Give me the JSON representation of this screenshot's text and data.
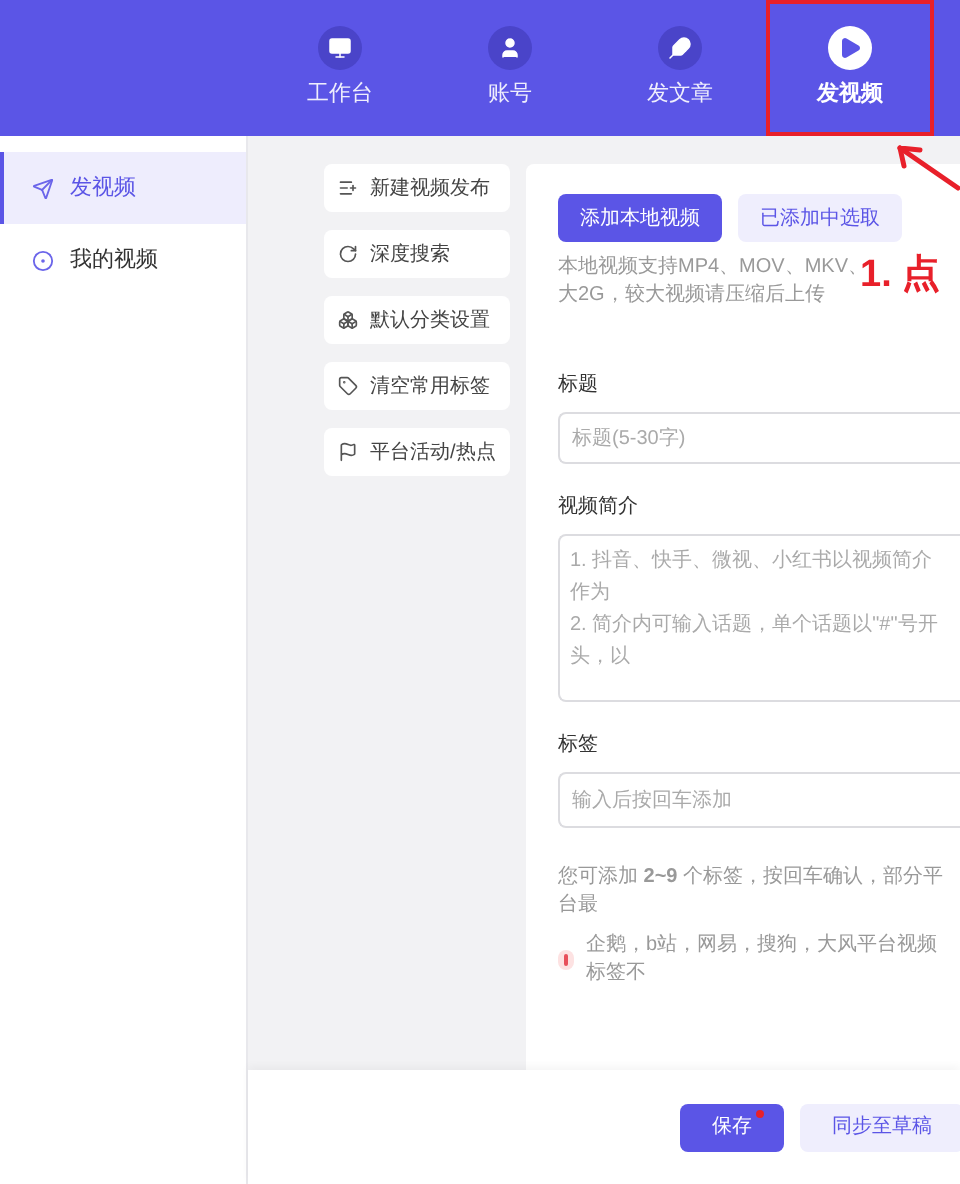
{
  "top_tabs": [
    {
      "label": "工作台",
      "selected": false,
      "highlighted": false
    },
    {
      "label": "账号",
      "selected": false,
      "highlighted": false
    },
    {
      "label": "发文章",
      "selected": false,
      "highlighted": false
    },
    {
      "label": "发视频",
      "selected": true,
      "highlighted": true
    }
  ],
  "sidebar": {
    "items": [
      {
        "label": "发视频",
        "selected": true
      },
      {
        "label": "我的视频",
        "selected": false
      }
    ]
  },
  "shortcuts": [
    {
      "label": "新建视频发布"
    },
    {
      "label": "深度搜索"
    },
    {
      "label": "默认分类设置"
    },
    {
      "label": "清空常用标签"
    },
    {
      "label": "平台活动/热点"
    }
  ],
  "upload": {
    "buttons": [
      {
        "label": "添加本地视频",
        "kind": "primary"
      },
      {
        "label": "已添加中选取",
        "kind": "secondary"
      }
    ],
    "hint_lines": [
      "本地视频支持MP4、MOV、MKV、",
      "大2G，较大视频请压缩后上传"
    ]
  },
  "title_field": {
    "label": "标题",
    "placeholder": "标题(5-30字)"
  },
  "intro_field": {
    "label": "视频简介",
    "placeholder_lines": [
      "1. 抖音、快手、微视、小红书以视频简介作为",
      "2. 简介内可输入话题，单个话题以\"#\"号开头，以"
    ]
  },
  "tags_field": {
    "label": "标签",
    "placeholder": "输入后按回车添加"
  },
  "tips": [
    {
      "text": "您可添加 **2~9** 个标签，按回车确认，部分平台最",
      "kind": "info"
    },
    {
      "text": "企鹅，b站，网易，搜狗，大风平台视频标签不",
      "kind": "warning"
    }
  ],
  "footer_buttons": [
    {
      "label": "保存",
      "kind": "primary",
      "dot": true
    },
    {
      "label": "同步至草稿",
      "kind": "secondary",
      "dot": false
    }
  ],
  "annotation": {
    "text": "1. 点"
  }
}
